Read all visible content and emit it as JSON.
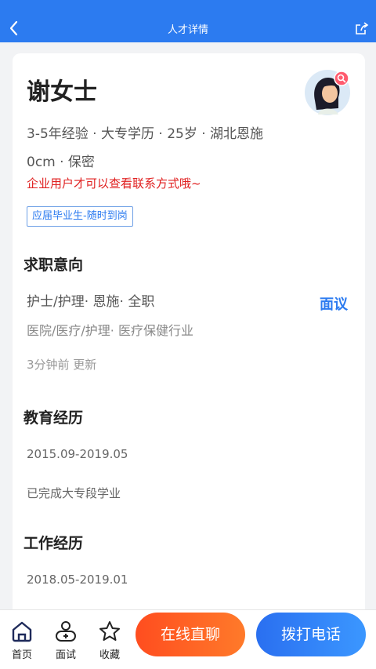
{
  "header": {
    "title": "人才详情",
    "back_icon": "back-icon",
    "share_icon": "share-icon"
  },
  "profile": {
    "name": "谢女士",
    "meta_line1": "3-5年经验 · 大专学历 · 25岁 · 湖北恩施",
    "meta_line2": "0cm · 保密",
    "notice": "企业用户才可以查看联系方式哦~",
    "tag": "应届毕业生-随时到岗"
  },
  "intent": {
    "title": "求职意向",
    "position": "护士/护理· 恩施· 全职",
    "industry": "医院/医疗/护理· 医疗保健行业",
    "salary": "面议",
    "updated": "3分钟前 更新"
  },
  "education": {
    "title": "教育经历",
    "dates": "2015.09-2019.05",
    "description": "已完成大专段学业"
  },
  "work": {
    "title": "工作经历",
    "dates": "2018.05-2019.01"
  },
  "bottom": {
    "nav": [
      {
        "label": "首页",
        "icon": "home-icon"
      },
      {
        "label": "面试",
        "icon": "interview-icon"
      },
      {
        "label": "收藏",
        "icon": "star-icon"
      }
    ],
    "chat_button": "在线直聊",
    "call_button": "拨打电话"
  },
  "colors": {
    "primary": "#2c7bf0",
    "notice": "#e02020",
    "chat": "#ff5a22",
    "call": "#2f7cf5"
  }
}
